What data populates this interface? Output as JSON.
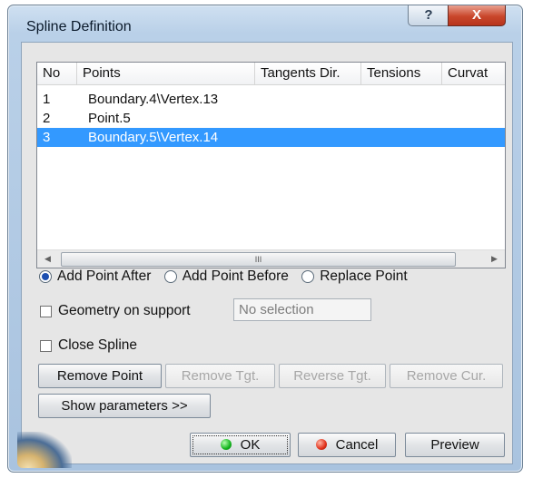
{
  "window": {
    "title": "Spline Definition",
    "help_label": "?",
    "close_label": "X"
  },
  "list": {
    "columns": [
      "No",
      "Points",
      "Tangents Dir.",
      "Tensions",
      "Curvat"
    ],
    "rows": [
      {
        "no": "1",
        "point": "Boundary.4\\Vertex.13",
        "selected": false
      },
      {
        "no": "2",
        "point": "Point.5",
        "selected": false
      },
      {
        "no": "3",
        "point": "Boundary.5\\Vertex.14",
        "selected": true
      }
    ],
    "scroll_thumb_grip": "III"
  },
  "options": {
    "add_after": {
      "label": "Add Point After",
      "selected": true
    },
    "add_before": {
      "label": "Add Point Before",
      "selected": false
    },
    "replace": {
      "label": "Replace Point",
      "selected": false
    }
  },
  "geometry_on_support": {
    "label": "Geometry on support",
    "checked": false,
    "field_value": "No selection"
  },
  "close_spline": {
    "label": "Close Spline",
    "checked": false
  },
  "buttons": {
    "remove_point": "Remove Point",
    "remove_tgt": "Remove Tgt.",
    "reverse_tgt": "Reverse Tgt.",
    "remove_cur": "Remove Cur.",
    "show_parameters": "Show parameters >>",
    "ok": "OK",
    "cancel": "Cancel",
    "preview": "Preview"
  },
  "colors": {
    "selection": "#3399ff",
    "title_bar": "#b9d0e8",
    "close_button": "#c9462b",
    "dialog_body": "#e6e6e6"
  },
  "icons": {
    "ok_led": "green-led-icon",
    "cancel_led": "red-led-icon"
  }
}
